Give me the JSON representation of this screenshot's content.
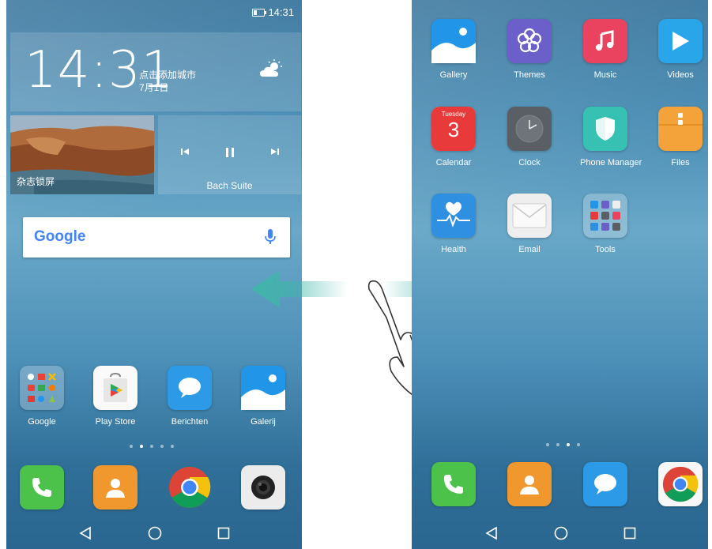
{
  "left_screen": {
    "status_time": "14:31",
    "clock": {
      "time": "14:31",
      "city_prompt": "点击添加城市",
      "date": "7月1日"
    },
    "magazine_label": "杂志锁屏",
    "music": {
      "title": "Bach Suite"
    },
    "google_bar": {
      "logo_text": "Google"
    },
    "apps": [
      {
        "label": "Google"
      },
      {
        "label": "Play Store"
      },
      {
        "label": "Berichten"
      },
      {
        "label": "Galerij"
      }
    ]
  },
  "right_screen": {
    "apps": [
      {
        "label": "Gallery"
      },
      {
        "label": "Themes"
      },
      {
        "label": "Music"
      },
      {
        "label": "Videos"
      },
      {
        "label": "Calendar",
        "day_name": "Tuesday",
        "day_number": "3"
      },
      {
        "label": "Clock"
      },
      {
        "label": "Phone Manager"
      },
      {
        "label": "Files"
      },
      {
        "label": "Health"
      },
      {
        "label": "Email"
      },
      {
        "label": "Tools"
      }
    ]
  },
  "colors": {
    "phone_green": "#4cc24a",
    "contacts_orange": "#f0972d",
    "messages_blue": "#2c9ae6",
    "music_red": "#e9435f",
    "themes_purple": "#6b5fc9",
    "gesture_arrow": "#3fb6a8"
  }
}
